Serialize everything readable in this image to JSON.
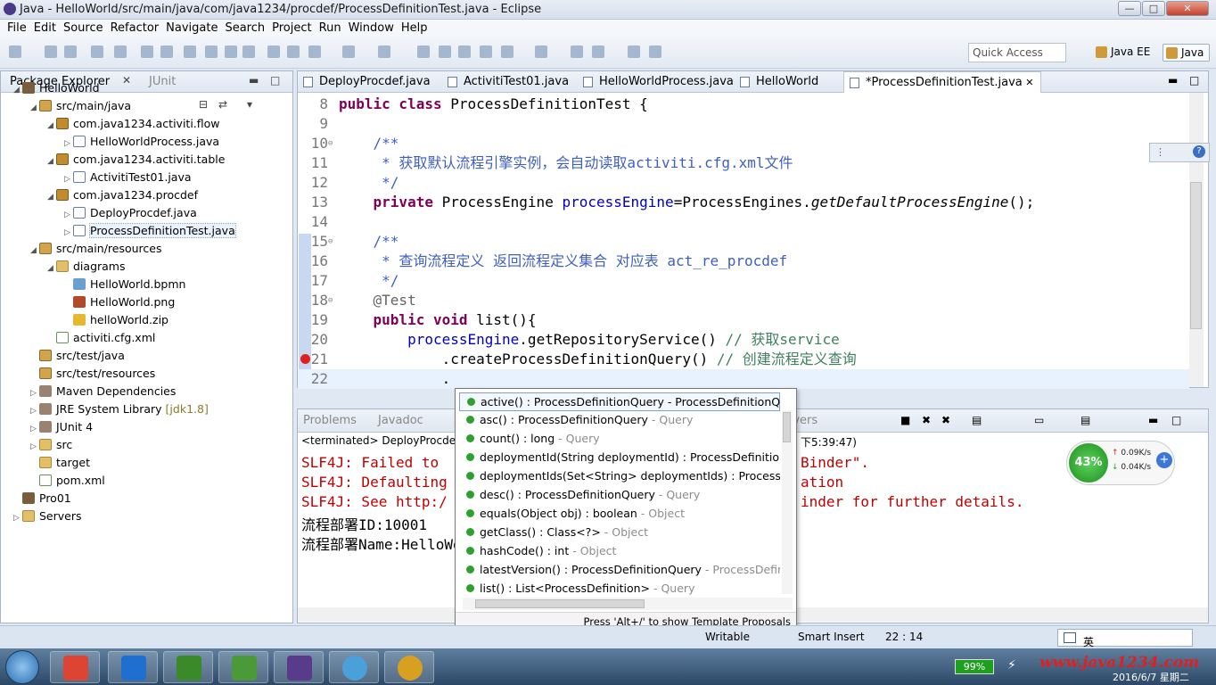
{
  "window": {
    "title": "Java - HelloWorld/src/main/java/com/java1234/procdef/ProcessDefinitionTest.java - Eclipse"
  },
  "menu": [
    "File",
    "Edit",
    "Source",
    "Refactor",
    "Navigate",
    "Search",
    "Project",
    "Run",
    "Window",
    "Help"
  ],
  "toolbar": {
    "quick_access": "Quick Access",
    "perspectives": [
      "Java EE",
      "Java"
    ]
  },
  "explorer": {
    "tabs": [
      "Package Explorer",
      "JUnit"
    ],
    "tree": [
      {
        "label": "HelloWorld",
        "depth": 0,
        "icon": "project-icon",
        "expanded": true
      },
      {
        "label": "src/main/java",
        "depth": 1,
        "icon": "source-folder-icon",
        "expanded": true
      },
      {
        "label": "com.java1234.activiti.flow",
        "depth": 2,
        "icon": "package-icon",
        "expanded": true
      },
      {
        "label": "HelloWorldProcess.java",
        "depth": 3,
        "icon": "java-file-icon",
        "expanded": false
      },
      {
        "label": "com.java1234.activiti.table",
        "depth": 2,
        "icon": "package-icon",
        "expanded": true
      },
      {
        "label": "ActivitiTest01.java",
        "depth": 3,
        "icon": "java-file-icon",
        "expanded": false
      },
      {
        "label": "com.java1234.procdef",
        "depth": 2,
        "icon": "package-icon",
        "expanded": true
      },
      {
        "label": "DeployProcdef.java",
        "depth": 3,
        "icon": "java-file-icon",
        "expanded": false
      },
      {
        "label": "ProcessDefinitionTest.java",
        "depth": 3,
        "icon": "java-file-icon",
        "expanded": false,
        "selected": true
      },
      {
        "label": "src/main/resources",
        "depth": 1,
        "icon": "source-folder-icon",
        "expanded": true
      },
      {
        "label": "diagrams",
        "depth": 2,
        "icon": "folder-icon",
        "expanded": true
      },
      {
        "label": "HelloWorld.bpmn",
        "depth": 3,
        "icon": "bpmn-file-icon"
      },
      {
        "label": "HelloWorld.png",
        "depth": 3,
        "icon": "image-file-icon"
      },
      {
        "label": "helloWorld.zip",
        "depth": 3,
        "icon": "zip-file-icon"
      },
      {
        "label": "activiti.cfg.xml",
        "depth": 2,
        "icon": "xml-file-icon"
      },
      {
        "label": "src/test/java",
        "depth": 1,
        "icon": "source-folder-icon"
      },
      {
        "label": "src/test/resources",
        "depth": 1,
        "icon": "source-folder-icon"
      },
      {
        "label": "Maven Dependencies",
        "depth": 1,
        "icon": "library-icon",
        "expanded": false
      },
      {
        "label": "JRE System Library",
        "deco": "[jdk1.8]",
        "depth": 1,
        "icon": "library-icon",
        "expanded": false
      },
      {
        "label": "JUnit 4",
        "depth": 1,
        "icon": "library-icon",
        "expanded": false
      },
      {
        "label": "src",
        "depth": 1,
        "icon": "folder-icon",
        "expanded": false
      },
      {
        "label": "target",
        "depth": 1,
        "icon": "folder-icon"
      },
      {
        "label": "pom.xml",
        "depth": 1,
        "icon": "xml-file-icon"
      },
      {
        "label": "Pro01",
        "depth": 0,
        "icon": "project-icon"
      },
      {
        "label": "Servers",
        "depth": 0,
        "icon": "folder-icon",
        "expanded": false
      }
    ]
  },
  "editor": {
    "tabs": [
      {
        "label": "DeployProcdef.java",
        "active": false
      },
      {
        "label": "ActivitiTest01.java",
        "active": false
      },
      {
        "label": "HelloWorldProcess.java",
        "active": false
      },
      {
        "label": "HelloWorld",
        "active": false
      },
      {
        "label": "*ProcessDefinitionTest.java",
        "active": true
      }
    ],
    "lines": [
      {
        "n": "8",
        "parts": [
          [
            "k",
            "public class "
          ],
          [
            "",
            "ProcessDefinitionTest {"
          ]
        ]
      },
      {
        "n": "9",
        "parts": []
      },
      {
        "n": "10",
        "fold": true,
        "parts": [
          [
            "cm",
            "    /**"
          ]
        ]
      },
      {
        "n": "11",
        "parts": [
          [
            "cm",
            "     * 获取默认流程引擎实例，会自动读取activiti.cfg.xml文件"
          ]
        ]
      },
      {
        "n": "12",
        "parts": [
          [
            "cm",
            "     */"
          ]
        ]
      },
      {
        "n": "13",
        "parts": [
          [
            "k",
            "    private "
          ],
          [
            "",
            "ProcessEngine "
          ],
          [
            "f",
            "processEngine"
          ],
          [
            "",
            "=ProcessEngines."
          ],
          [
            "it",
            "getDefaultProcessEngine"
          ],
          [
            "",
            "();"
          ]
        ]
      },
      {
        "n": "14",
        "parts": []
      },
      {
        "n": "15",
        "fold": true,
        "parts": [
          [
            "cm",
            "    /**"
          ]
        ]
      },
      {
        "n": "16",
        "parts": [
          [
            "cm",
            "     * 查询流程定义 返回流程定义集合 对应表 act_re_procdef"
          ]
        ]
      },
      {
        "n": "17",
        "parts": [
          [
            "cm",
            "     */"
          ]
        ]
      },
      {
        "n": "18",
        "fold": true,
        "parts": [
          [
            "an",
            "    @Test"
          ]
        ]
      },
      {
        "n": "19",
        "parts": [
          [
            "k",
            "    public void "
          ],
          [
            "",
            "list(){"
          ]
        ]
      },
      {
        "n": "20",
        "parts": [
          [
            "",
            "        "
          ],
          [
            "f",
            "processEngine"
          ],
          [
            "",
            ".getRepositoryService() "
          ],
          [
            "cm2",
            "// 获取service"
          ]
        ]
      },
      {
        "n": "21",
        "error": true,
        "parts": [
          [
            "",
            "            .createProcessDefinitionQuery() "
          ],
          [
            "cm2",
            "// 创建流程定义查询"
          ]
        ]
      },
      {
        "n": "22",
        "current": true,
        "parts": [
          [
            "",
            "            ."
          ]
        ]
      }
    ]
  },
  "console": {
    "tabs": [
      "Problems",
      "Javadoc",
      "rvers"
    ],
    "terminated": "<terminated> DeployProcdef.",
    "time_suffix": "下5:39:47)",
    "lines": [
      {
        "left": "SLF4J: Failed to ",
        "right": "Binder\".",
        "err": true
      },
      {
        "left": "SLF4J: Defaulting",
        "right": "ation",
        "err": true
      },
      {
        "left": "SLF4J: See http:/",
        "right": "inder for further details.",
        "err": true
      },
      {
        "left": "流程部署ID:10001",
        "right": "",
        "err": false
      },
      {
        "left": "流程部署Name:HelloWo",
        "right": "",
        "err": false
      }
    ]
  },
  "completion": {
    "items": [
      {
        "sig": "active() : ProcessDefinitionQuery",
        "owner": " - ProcessDefinitionQuery",
        "owner_dim": false,
        "selected": true
      },
      {
        "sig": "asc() : ProcessDefinitionQuery",
        "owner": " - Query",
        "owner_dim": true
      },
      {
        "sig": "count() : long",
        "owner": " - Query",
        "owner_dim": true
      },
      {
        "sig": "deploymentId(String deploymentId) : ProcessDefinitionQu",
        "owner": "",
        "owner_dim": true
      },
      {
        "sig": "deploymentIds(Set<String> deploymentIds) : ProcessDefi",
        "owner": "",
        "owner_dim": true
      },
      {
        "sig": "desc() : ProcessDefinitionQuery",
        "owner": " - Query",
        "owner_dim": true
      },
      {
        "sig": "equals(Object obj) : boolean",
        "owner": " - Object",
        "owner_dim": true
      },
      {
        "sig": "getClass() : Class<?>",
        "owner": " - Object",
        "owner_dim": true
      },
      {
        "sig": "hashCode() : int",
        "owner": " - Object",
        "owner_dim": true
      },
      {
        "sig": "latestVersion() : ProcessDefinitionQuery",
        "owner": " - ProcessDefinitio",
        "owner_dim": true
      },
      {
        "sig": "list() : List<ProcessDefinition>",
        "owner": " - Query",
        "owner_dim": true
      }
    ],
    "footer": "Press 'Alt+/' to show Template Proposals"
  },
  "status": {
    "writable": "Writable",
    "insert_mode": "Smart Insert",
    "position": "22 : 14",
    "ime": "英"
  },
  "net": {
    "percent": "43%",
    "up": "0.09K/s",
    "down": "0.04K/s"
  },
  "taskbar": {
    "battery": "99%",
    "watermark": "www.java1234.com",
    "date": "2016/6/7 星期二"
  }
}
